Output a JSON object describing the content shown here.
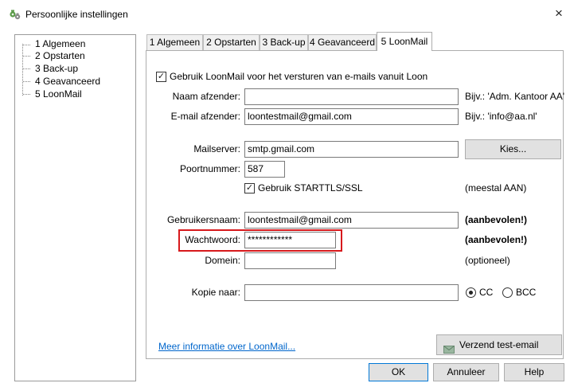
{
  "window": {
    "title": "Persoonlijke instellingen",
    "app_icon": "settings-gears-icon",
    "close_label": "×"
  },
  "tree": {
    "items": [
      {
        "label": "1 Algemeen"
      },
      {
        "label": "2 Opstarten"
      },
      {
        "label": "3 Back-up"
      },
      {
        "label": "4 Geavanceerd"
      },
      {
        "label": "5 LoonMail",
        "selected": true
      }
    ]
  },
  "tabs": [
    {
      "label": "1 Algemeen"
    },
    {
      "label": "2 Opstarten"
    },
    {
      "label": "3 Back-up"
    },
    {
      "label": "4 Geavanceerd"
    },
    {
      "label": "5 LoonMail",
      "active": true
    }
  ],
  "form": {
    "use_loonmail": {
      "label": "Gebruik LoonMail voor het versturen van e-mails vanuit Loon",
      "checked": true
    },
    "sender_name": {
      "label": "Naam afzender:",
      "value": "",
      "hint": "Bijv.: 'Adm. Kantoor AA'"
    },
    "sender_email": {
      "label": "E-mail afzender:",
      "value": "loontestmail@gmail.com",
      "hint": "Bijv.: 'info@aa.nl'"
    },
    "mailserver": {
      "label": "Mailserver:",
      "value": "smtp.gmail.com",
      "button": "Kies..."
    },
    "port": {
      "label": "Poortnummer:",
      "value": "587"
    },
    "starttls": {
      "label": "Gebruik STARTTLS/SSL",
      "checked": true,
      "hint": "(meestal AAN)"
    },
    "username": {
      "label": "Gebruikersnaam:",
      "value": "loontestmail@gmail.com",
      "hint": "(aanbevolen!)"
    },
    "password": {
      "label": "Wachtwoord:",
      "value": "************",
      "hint": "(aanbevolen!)"
    },
    "domain": {
      "label": "Domein:",
      "value": "",
      "hint": "(optioneel)"
    },
    "copy_to": {
      "label": "Kopie naar:",
      "value": "",
      "options": [
        "CC",
        "BCC"
      ],
      "selected": "CC"
    },
    "more_info_link": "Meer informatie over LoonMail...",
    "test_button": "Verzend test-email"
  },
  "footer": {
    "ok": "OK",
    "cancel": "Annuleer",
    "help": "Help"
  },
  "colors": {
    "highlight_box": "#d7191c",
    "link": "#0066cc"
  }
}
